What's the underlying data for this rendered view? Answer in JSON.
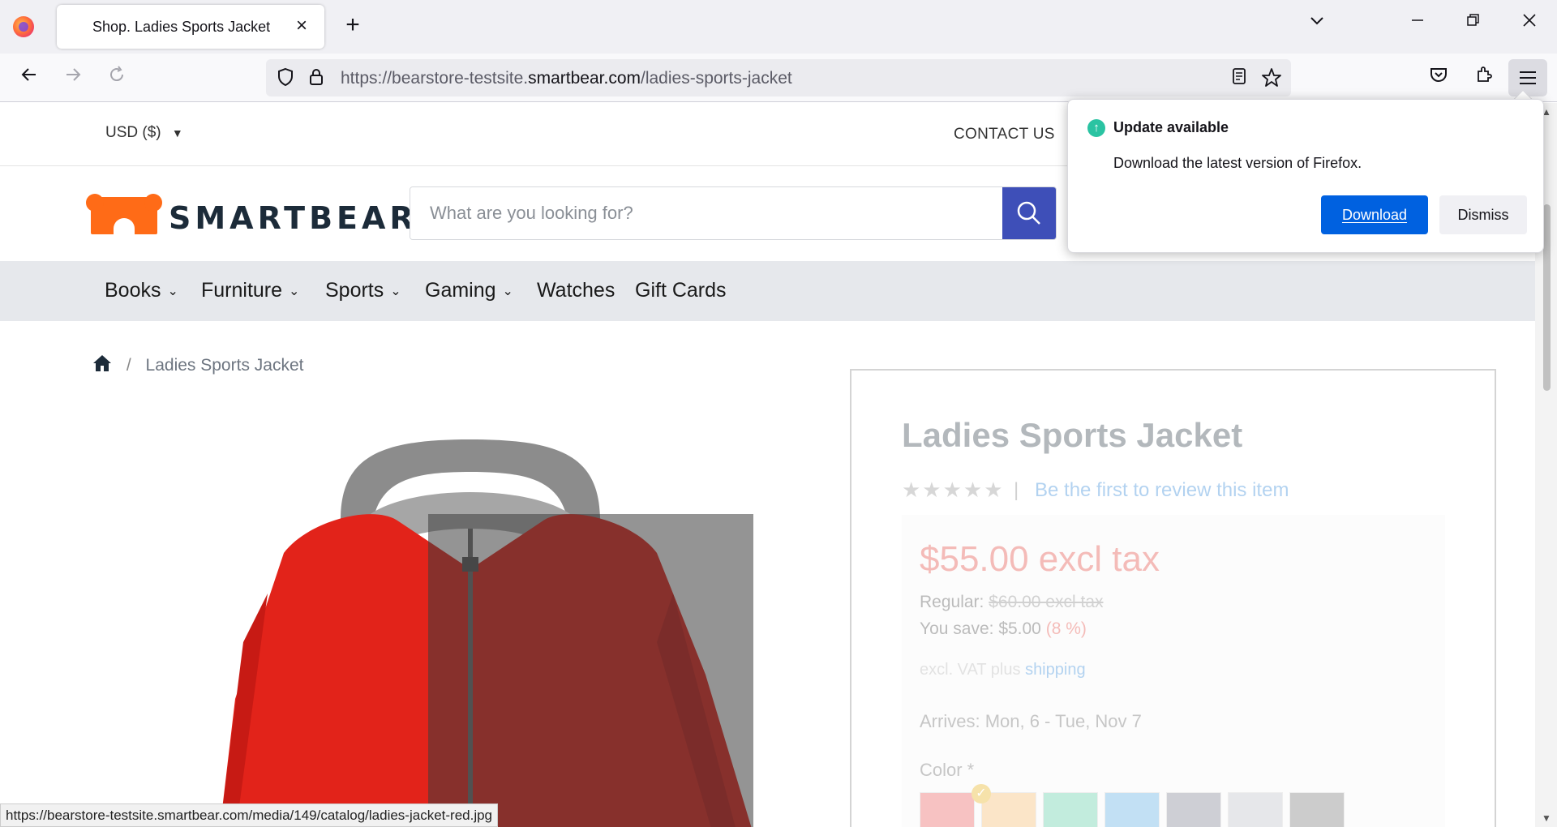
{
  "browser": {
    "tab_title": "Shop. Ladies Sports Jacket",
    "tab_close": "×",
    "new_tab": "+",
    "url_prefix": "https://bearstore-testsite.",
    "url_host": "smartbear.com",
    "url_path": "/ladies-sports-jacket",
    "status_url": "https://bearstore-testsite.smartbear.com/media/149/catalog/ladies-jacket-red.jpg"
  },
  "update_popup": {
    "title": "Update available",
    "message": "Download the latest version of Firefox.",
    "download_label": "Download",
    "dismiss_label": "Dismiss"
  },
  "store": {
    "currency": "USD   ($)",
    "contact": "CONTACT US",
    "logo_text": "SMARTBEAR",
    "search_placeholder": "What are you looking for?",
    "categories": [
      {
        "label": "Books",
        "has_dropdown": true
      },
      {
        "label": "Furniture",
        "has_dropdown": true
      },
      {
        "label": "Sports",
        "has_dropdown": true
      },
      {
        "label": "Gaming",
        "has_dropdown": true
      },
      {
        "label": "Watches",
        "has_dropdown": false
      },
      {
        "label": "Gift Cards",
        "has_dropdown": false
      }
    ],
    "breadcrumb": {
      "sep": "/",
      "current": "Ladies Sports Jacket"
    }
  },
  "product": {
    "title": "Ladies Sports Jacket",
    "stars": "★★★★★",
    "review_sep": "|",
    "review_link": "Be the first to review this item",
    "price": "$55.00 excl tax",
    "regular_label": "Regular:",
    "regular_price": "$60.00 excl tax",
    "save_label": "You save:",
    "save_amount": "$5.00",
    "save_pct": "(8 %)",
    "vat_text": "excl. VAT plus",
    "shipping_link": "shipping",
    "arrives_label": "Arrives:",
    "arrives_value": "Mon, 6 - Tue, Nov 7",
    "color_label": "Color *",
    "swatches": [
      "#e84a4a",
      "#f3b35c",
      "#49c79a",
      "#4aa3e0",
      "#6e7182",
      "#b5b8c0",
      "#666666"
    ],
    "selected_swatch": 0
  },
  "colors": {
    "accent_blue": "#3e4fb8",
    "price_red": "#e0352b",
    "firefox_download": "#0061e0",
    "brand_orange": "#ff6b17"
  }
}
